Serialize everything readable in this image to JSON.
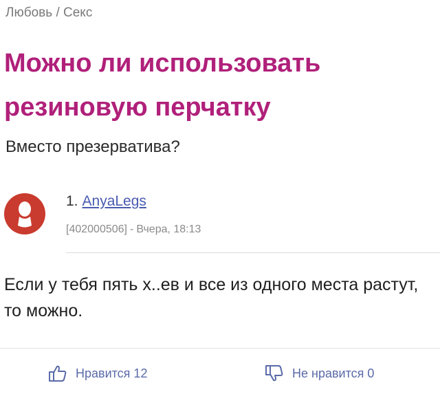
{
  "breadcrumb": {
    "category": "Любовь",
    "separator": "/",
    "subcategory": "Секс"
  },
  "question": {
    "title": "Можно ли использовать резиновую перчатку",
    "body": "Вместо презерватива?"
  },
  "answer": {
    "number": "1.",
    "author": "AnyaLegs",
    "user_id": "[402000506]",
    "meta_separator": "-",
    "time": "Вчера, 18:13",
    "text": "Если у тебя пять х..ев и все из одного места растут, то можно.",
    "like_label": "Нравится 12",
    "dislike_label": "Не нравится 0"
  },
  "colors": {
    "title": "#b0207a",
    "avatar": "#c93b2e",
    "link": "#4a5bb0",
    "vote": "#5a6aa8"
  },
  "icons": {
    "avatar": "user-silhouette-icon",
    "like": "thumbs-up-icon",
    "dislike": "thumbs-down-icon"
  }
}
